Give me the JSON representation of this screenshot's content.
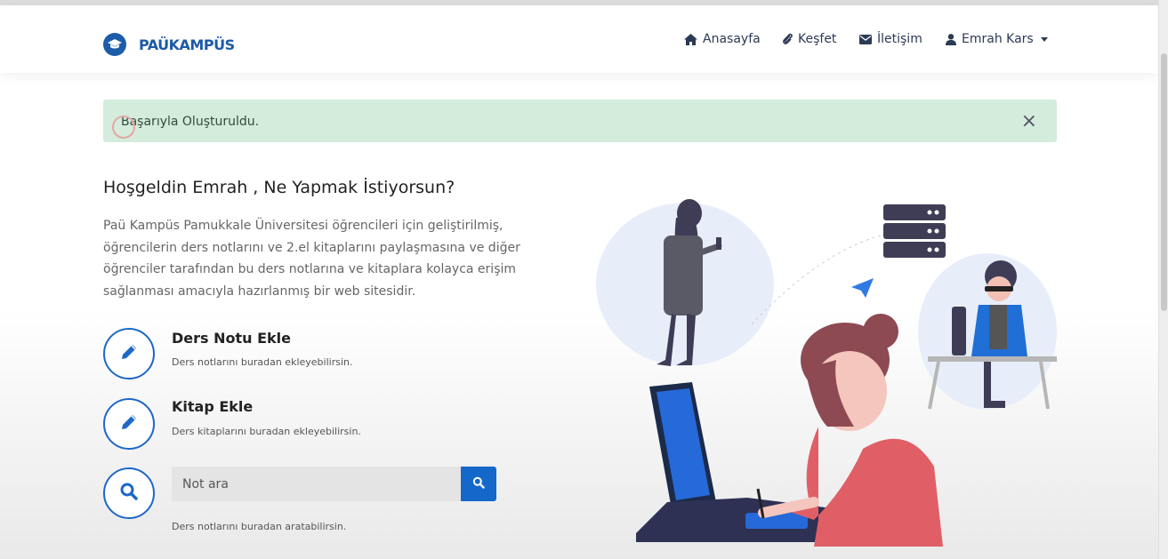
{
  "brand": {
    "name": "PAÜKAMPÜS"
  },
  "nav": {
    "home": "Anasayfa",
    "explore": "Keşfet",
    "contact": "İletişim",
    "user": "Emrah Kars"
  },
  "alert": {
    "message": "Başarıyla Oluşturuldu.",
    "close": "×"
  },
  "main": {
    "title": "Hoşgeldin Emrah , Ne Yapmak İstiyorsun?",
    "intro": "Paü Kampüs Pamukkale Üniversitesi öğrencileri için geliştirilmiş, öğrencilerin ders notlarını ve 2.el kitaplarını paylaşmasına ve diğer öğrenciler tarafından bu ders notlarına ve kitaplara kolayca erişim sağlanması amacıyla hazırlanmış bir web sitesidir.",
    "actions": [
      {
        "title": "Ders Notu Ekle",
        "desc": "Ders notlarını buradan ekleyebilirsin."
      },
      {
        "title": "Kitap Ekle",
        "desc": "Ders kitaplarını buradan ekleyebilirsin."
      }
    ],
    "search": {
      "placeholder": "Not ara",
      "desc": "Ders notlarını buradan aratabilirsin."
    }
  },
  "colors": {
    "primary": "#1468c9",
    "brand": "#1c5aa6",
    "alert_bg": "#d4ecdb"
  },
  "icons": [
    "graduation-cap-icon",
    "home-icon",
    "paperclip-icon",
    "envelope-icon",
    "user-icon",
    "caret-down-icon",
    "close-icon",
    "pencil-icon",
    "search-icon"
  ]
}
